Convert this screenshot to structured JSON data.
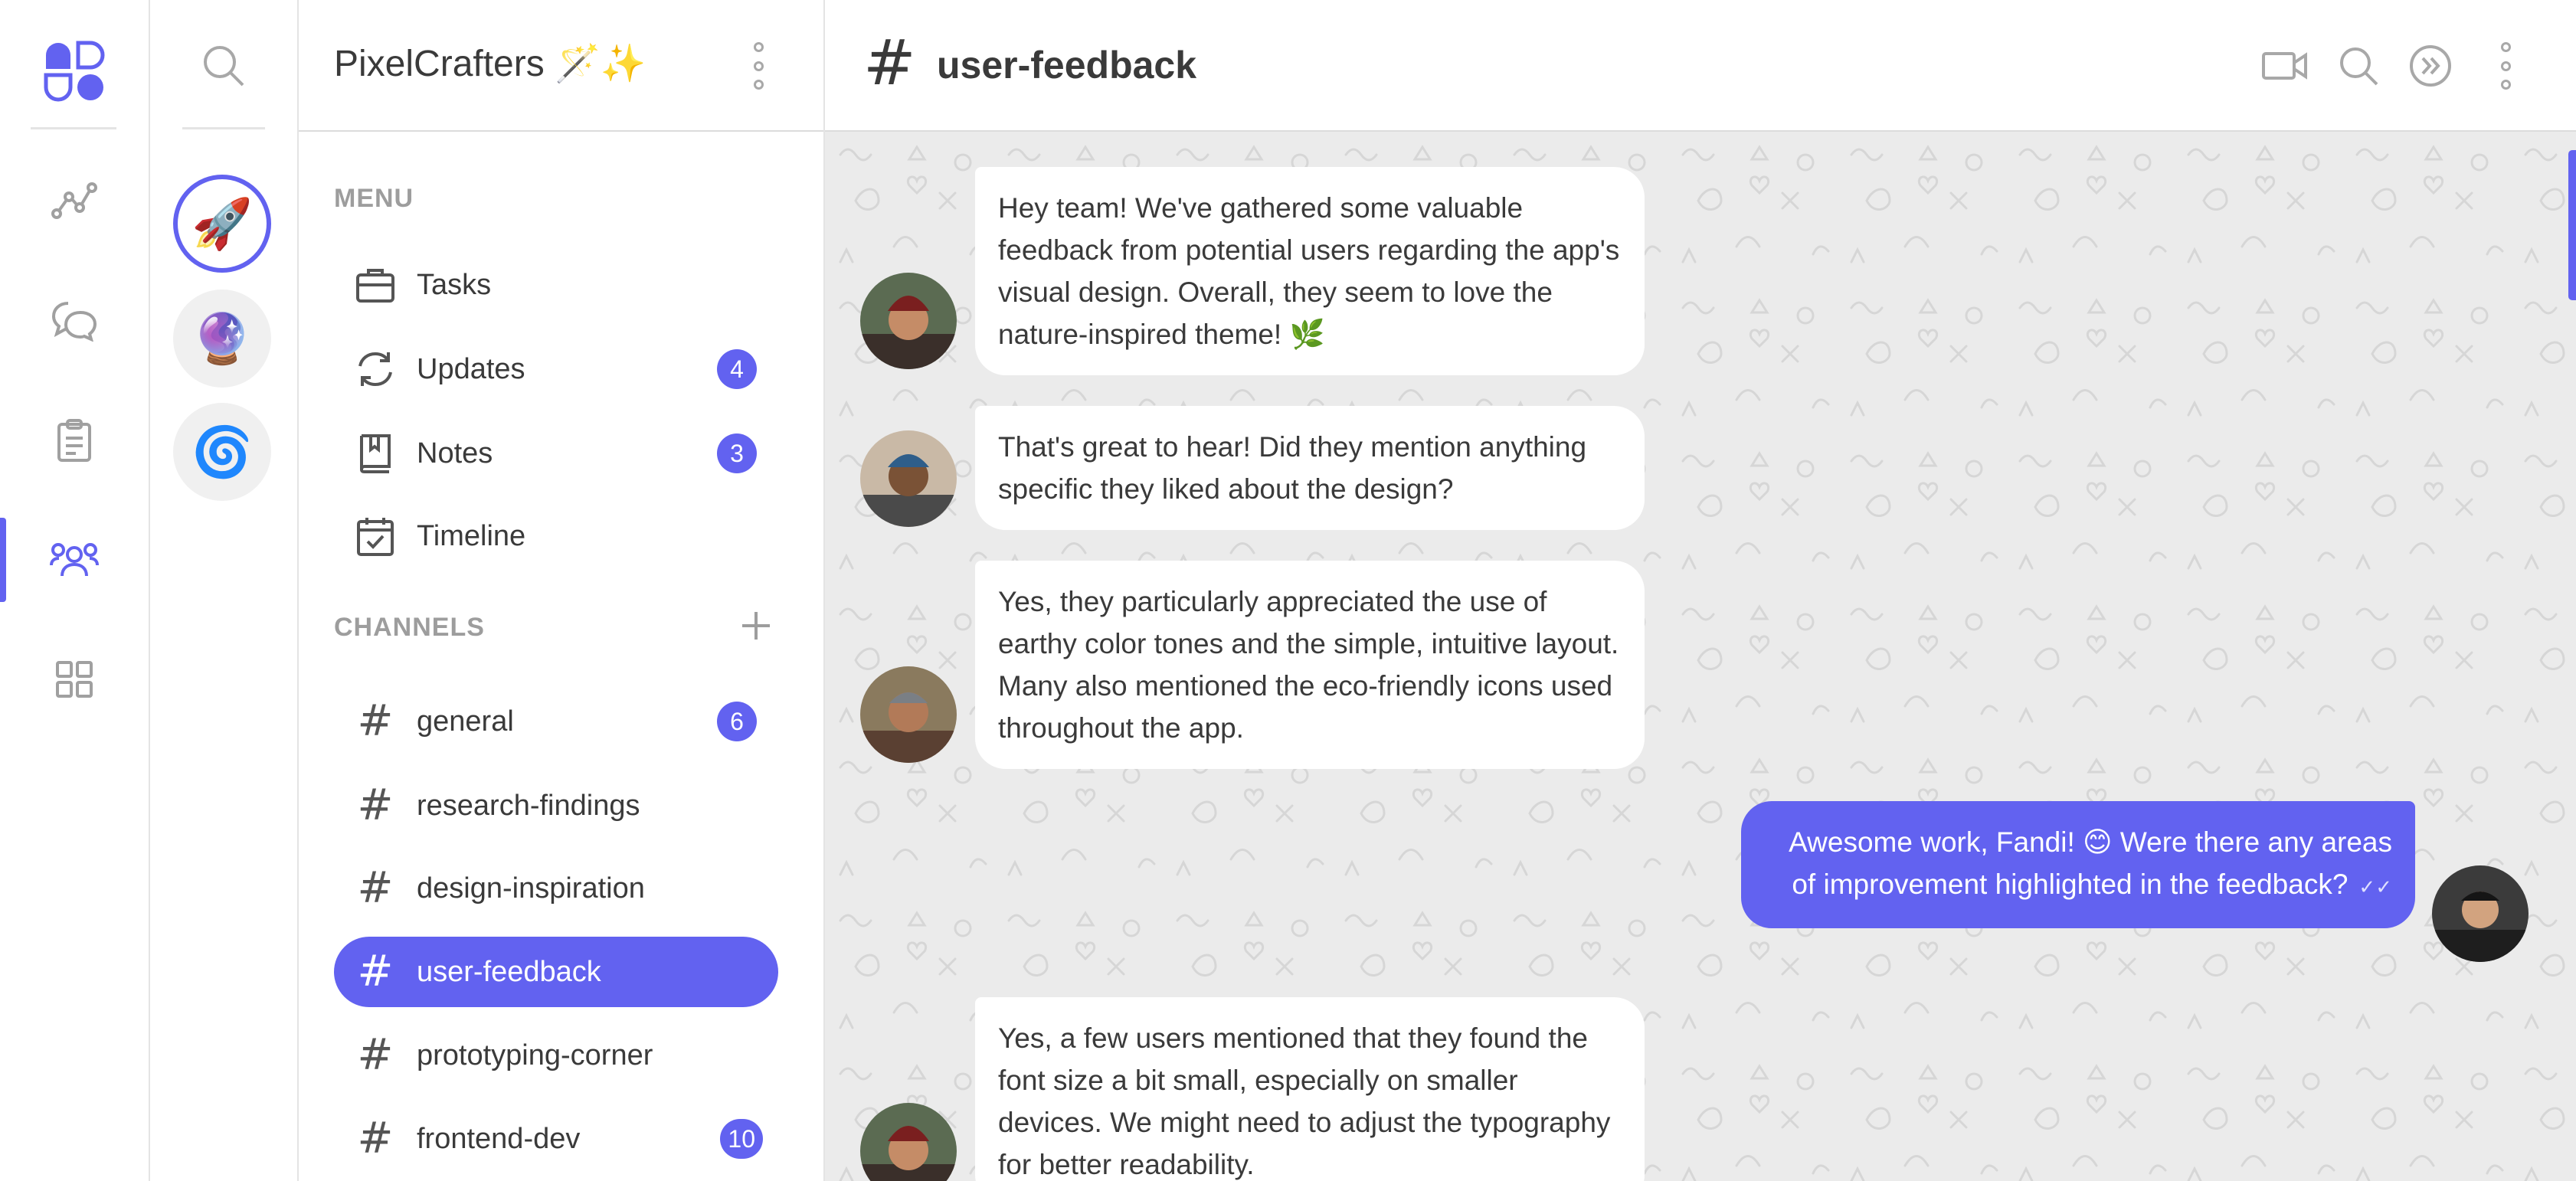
{
  "rail": {
    "logo": "app-logo",
    "items": [
      {
        "name": "analytics-icon"
      },
      {
        "name": "chat-icon"
      },
      {
        "name": "clipboard-icon"
      },
      {
        "name": "team-icon",
        "active": true
      },
      {
        "name": "grid-icon"
      }
    ],
    "accent": "#6262f0"
  },
  "servers": [
    {
      "emoji": "🚀",
      "active": true
    },
    {
      "emoji": "🔮"
    },
    {
      "emoji": "🌀"
    }
  ],
  "workspace": {
    "title": "PixelCrafters 🪄✨"
  },
  "menu": {
    "label": "MENU",
    "items": [
      {
        "label": "Tasks",
        "icon": "briefcase-icon"
      },
      {
        "label": "Updates",
        "icon": "refresh-icon",
        "badge": "4"
      },
      {
        "label": "Notes",
        "icon": "book-icon",
        "badge": "3"
      },
      {
        "label": "Timeline",
        "icon": "calendar-icon"
      }
    ]
  },
  "channels": {
    "label": "CHANNELS",
    "items": [
      {
        "label": "general",
        "badge": "6"
      },
      {
        "label": "research-findings"
      },
      {
        "label": "design-inspiration"
      },
      {
        "label": "user-feedback",
        "active": true
      },
      {
        "label": "prototyping-corner"
      },
      {
        "label": "frontend-dev",
        "badge": "10"
      }
    ]
  },
  "header": {
    "title": "user-feedback",
    "icons": [
      "video-icon",
      "search-icon",
      "forward-icon",
      "more-icon"
    ]
  },
  "messages": [
    {
      "side": "left",
      "text": "Hey team! We've gathered some valuable feedback from potential users regarding the app's visual design. Overall, they seem to love the nature-inspired theme! 🌿"
    },
    {
      "side": "left",
      "text": "That's great to hear! Did they mention anything specific they liked about the design?"
    },
    {
      "side": "left",
      "text": "Yes, they particularly appreciated the use of earthy color tones and the simple, intuitive layout. Many also mentioned the eco-friendly icons used throughout the app."
    },
    {
      "side": "right",
      "text": "Awesome work, Fandi! 😊 Were there any areas of improvement highlighted in the feedback?",
      "status": "✓✓"
    },
    {
      "side": "left",
      "text": "Yes, a few users mentioned that they found the font size a bit small, especially on smaller devices. We might need to adjust the typography for better readability."
    }
  ]
}
